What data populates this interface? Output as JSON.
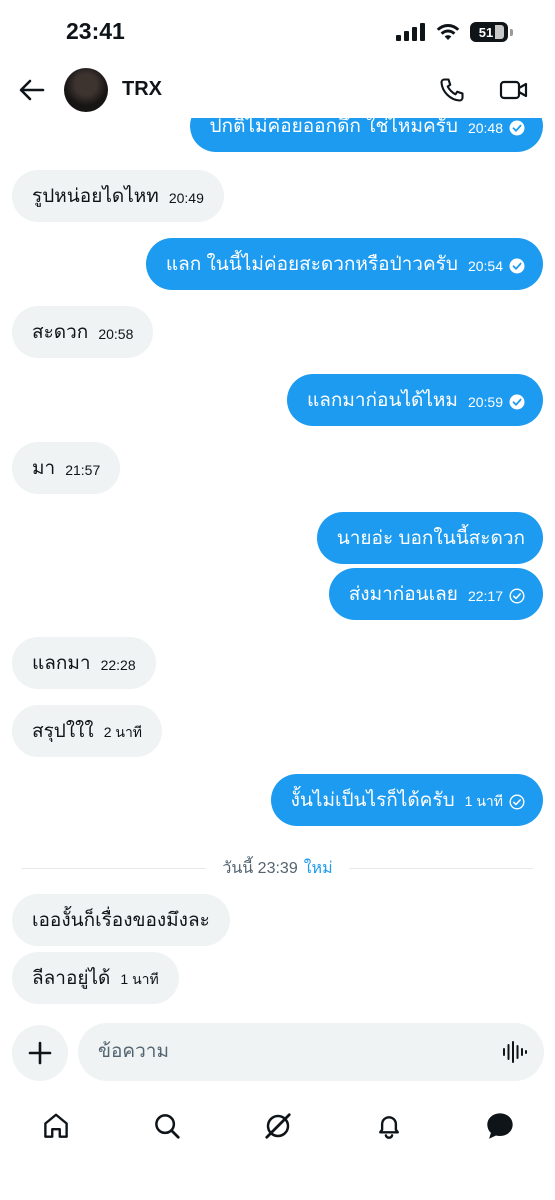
{
  "status_bar": {
    "time": "23:41",
    "battery": "51"
  },
  "header": {
    "contact_name": "TRX"
  },
  "messages": [
    {
      "dir": "out",
      "text": "ปกติไม่ค่อยออกดึก ใช่ไหมครับ",
      "time": "20:48",
      "status": "read"
    },
    {
      "dir": "in",
      "text": "รูปหน่อยไดไหท",
      "time": "20:49"
    },
    {
      "dir": "out",
      "text": "แลก ในนี้ไม่ค่อยสะดวกหรือป่าวครับ",
      "time": "20:54",
      "status": "read"
    },
    {
      "dir": "in",
      "text": "สะดวก",
      "time": "20:58"
    },
    {
      "dir": "out",
      "text": "แลกมาก่อนได้ไหม",
      "time": "20:59",
      "status": "read"
    },
    {
      "dir": "in",
      "text": "มา",
      "time": "21:57"
    },
    {
      "dir": "out",
      "text": "นายอ่ะ บอกในนี้สะดวก",
      "time": "",
      "status": ""
    },
    {
      "dir": "out",
      "text": "ส่งมาก่อนเลย",
      "time": "22:17",
      "status": "sent"
    },
    {
      "dir": "in",
      "text": "แลกมา",
      "time": "22:28"
    },
    {
      "dir": "in",
      "text": "สรุปใใใ",
      "time": "2 นาที"
    },
    {
      "dir": "out",
      "text": "งั้นไม่เป็นไรก็ได้ครับ",
      "time": "1 นาที",
      "status": "sent"
    },
    {
      "dir": "in",
      "text": "เอองั้นก็เรื่องของมึงละ",
      "time": ""
    },
    {
      "dir": "in",
      "text": "ลีลาอยู่ได้",
      "time": "1 นาที"
    }
  ],
  "divider": {
    "label": "วันนี้ 23:39",
    "new_label": "ใหม่"
  },
  "composer": {
    "placeholder": "ข้อความ",
    "value": ""
  },
  "icons": {
    "back": "arrow-left-icon",
    "call": "phone-icon",
    "video": "video-camera-icon",
    "plus": "plus-icon",
    "voice": "voice-waveform-icon",
    "nav": [
      "home-icon",
      "search-icon",
      "grok-icon",
      "bell-icon",
      "messages-icon"
    ]
  },
  "colors": {
    "accent": "#1d9bf0",
    "incoming_bubble": "#eff3f4",
    "text": "#0f1419",
    "muted": "#536471"
  }
}
